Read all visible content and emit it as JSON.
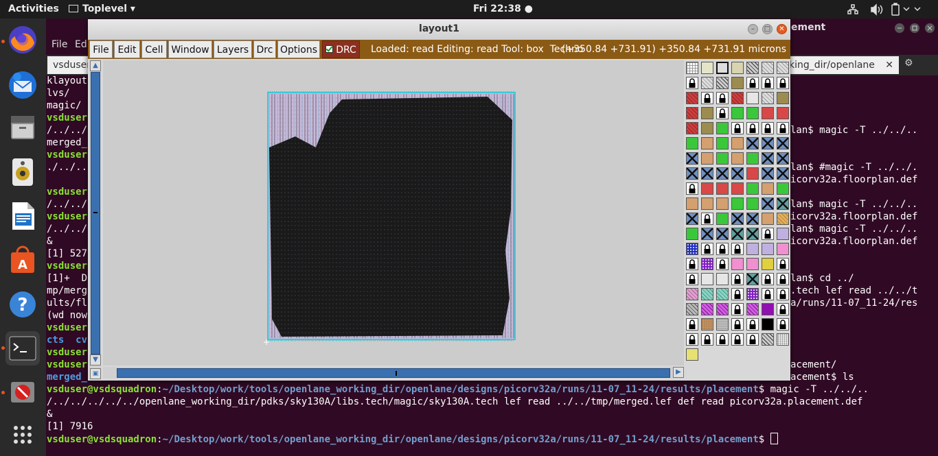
{
  "topbar": {
    "activities": "Activities",
    "app_menu": "Toplevel",
    "clock": "Fri 22:38"
  },
  "dock": {
    "apps": [
      "firefox-icon",
      "thunderbird-icon",
      "files-icon",
      "rhythmbox-icon",
      "writer-icon",
      "software-icon",
      "help-icon",
      "terminal-icon",
      "blocked-icon",
      "apps-grid-icon"
    ]
  },
  "terminal": {
    "menu_file": "File",
    "menu_edit": "Ed",
    "tab_left": "vsduser",
    "tab_right": "king_dir/openlane",
    "title_right": "ement",
    "left_lines": [
      {
        "t": "klayout",
        "c": "w"
      },
      {
        "t": "lvs/",
        "c": "w"
      },
      {
        "t": "magic/",
        "c": "w"
      },
      {
        "t": "vsduser",
        "c": "g"
      },
      {
        "t": "/../../",
        "c": "w"
      },
      {
        "t": "merged_",
        "c": "w"
      },
      {
        "t": "vsduser",
        "c": "g"
      },
      {
        "t": "./../..",
        "c": "w"
      },
      {
        "t": "",
        "c": "w"
      },
      {
        "t": "vsduser",
        "c": "g"
      },
      {
        "t": "/../../",
        "c": "w"
      },
      {
        "t": "vsduser",
        "c": "g"
      },
      {
        "t": "/../../",
        "c": "w"
      },
      {
        "t": "&",
        "c": "w"
      },
      {
        "t": "[1] 527",
        "c": "w"
      },
      {
        "t": "vsduser",
        "c": "g"
      },
      {
        "t": "[1]+  D",
        "c": "w"
      },
      {
        "t": "mp/merg",
        "c": "w"
      },
      {
        "t": "ults/fl",
        "c": "w"
      },
      {
        "t": "(wd now",
        "c": "w"
      },
      {
        "t": "vsduser",
        "c": "g"
      },
      {
        "t": "cts  cv",
        "c": "d"
      },
      {
        "t": "vsduser",
        "c": "g"
      },
      {
        "t": "vsduser",
        "c": "g"
      },
      {
        "t": "merged_",
        "c": "d"
      }
    ],
    "right_lines": [
      {
        "row": 4,
        "t": "lan$ magic -T ../../.."
      },
      {
        "row": 7,
        "t": "lan$ #magic -T ../../."
      },
      {
        "row": 8,
        "t": "icorv32a.floorplan.def"
      },
      {
        "row": 10,
        "t": "lan$ magic -T ../../.."
      },
      {
        "row": 11,
        "t": "icorv32a.floorplan.def"
      },
      {
        "row": 12,
        "t": "lan$ magic -T ../../.."
      },
      {
        "row": 13,
        "t": "icorv32a.floorplan.def"
      },
      {
        "row": 16,
        "t": "lan$ cd ../"
      },
      {
        "row": 17,
        "t": ".tech lef read ../../t"
      },
      {
        "row": 18,
        "t": "a/runs/11-07_11-24/res"
      },
      {
        "row": 23,
        "t": "acement/"
      },
      {
        "row": 24,
        "t": "acement$ ls"
      }
    ],
    "bottom": {
      "prompt_user": "vsduser@vsdsquadron",
      "prompt_path": "~/Desktop/work/tools/openlane_working_dir/openlane/designs/picorv32a/runs/11-07_11-24/results/placement",
      "cmd": "$ magic -T ../../..",
      "line2": "/../../../../../openlane_working_dir/pdks/sky130A/libs.tech/magic/sky130A.tech lef read ../../tmp/merged.lef def read picorv32a.placement.def",
      "line3": "&",
      "line4": "[1] 7916",
      "prompt_end": "$ "
    }
  },
  "magic": {
    "title": "layout1",
    "menu": [
      "File",
      "Edit",
      "Cell",
      "Window",
      "Layers",
      "Drc",
      "Options"
    ],
    "drc_label": "DRC",
    "drc_checked": true,
    "status": "Loaded: read Editing: read Tool: box  Techno",
    "coords": "(+350.84 +731.91) +350.84 +731.91 microns",
    "accent_color": "#8b5a14",
    "die_fill": "#1a1a1a",
    "die_background": "#c9b9d8",
    "die_border": "#3fc8d8"
  },
  "palette": {
    "rows": [
      [
        "grid",
        "plain",
        "outline",
        "beige",
        "diag-k",
        "diag-g",
        "diag-g"
      ],
      [
        "lock",
        "diag-g",
        "diag-k",
        "olive",
        "lock",
        "lock",
        "lock"
      ],
      [
        "red-h",
        "lock",
        "lock",
        "red-h",
        "light",
        "diag-g",
        "olive"
      ],
      [
        "red-h",
        "olive",
        "lock",
        "green",
        "green",
        "red",
        "red"
      ],
      [
        "red-h",
        "olive",
        "green",
        "lock",
        "lock",
        "lock",
        "lock"
      ],
      [
        "green",
        "tan",
        "green",
        "tan",
        "x-blue",
        "x-blue",
        "x-blue"
      ],
      [
        "x-blue",
        "tan",
        "green",
        "tan",
        "green",
        "x-blue",
        "x-blue"
      ],
      [
        "x-blue",
        "x-blue",
        "x-blue",
        "x-blue",
        "red",
        "x-blue",
        "x-blue"
      ],
      [
        "lock",
        "red",
        "red",
        "red",
        "green",
        "tan",
        "green"
      ],
      [
        "tan",
        "tan",
        "tan",
        "green",
        "green",
        "x-blue",
        "x-teal"
      ],
      [
        "x-blue",
        "lock",
        "green",
        "x-blue",
        "x-blue",
        "tan",
        "tan-h"
      ],
      [
        "green",
        "x-blue",
        "x-blue",
        "x-teal",
        "x-teal",
        "lock",
        "lavender"
      ],
      [
        "blue-d",
        "lock",
        "lock",
        "lock",
        "lavender",
        "lavender",
        "pink"
      ],
      [
        "lock",
        "purple-d",
        "lock",
        "pink",
        "pink",
        "yellow",
        "lock"
      ],
      [
        "lock",
        "light",
        "light",
        "lock",
        "x-teal",
        "lock",
        "lock"
      ],
      [
        "pink-h",
        "teal-h",
        "teal-h",
        "lock",
        "purple-d",
        "lock",
        "lock"
      ],
      [
        "gray-h",
        "purple-h",
        "purple-h",
        "lock",
        "purple-h",
        "purple",
        "lock"
      ],
      [
        "lock",
        "tan-d",
        "gray-w",
        "lock",
        "lock",
        "black",
        "lock"
      ],
      [
        "lock",
        "lock",
        "lock",
        "lock",
        "lock",
        "diag-k",
        "dots"
      ],
      [
        "yellow-s"
      ]
    ]
  }
}
